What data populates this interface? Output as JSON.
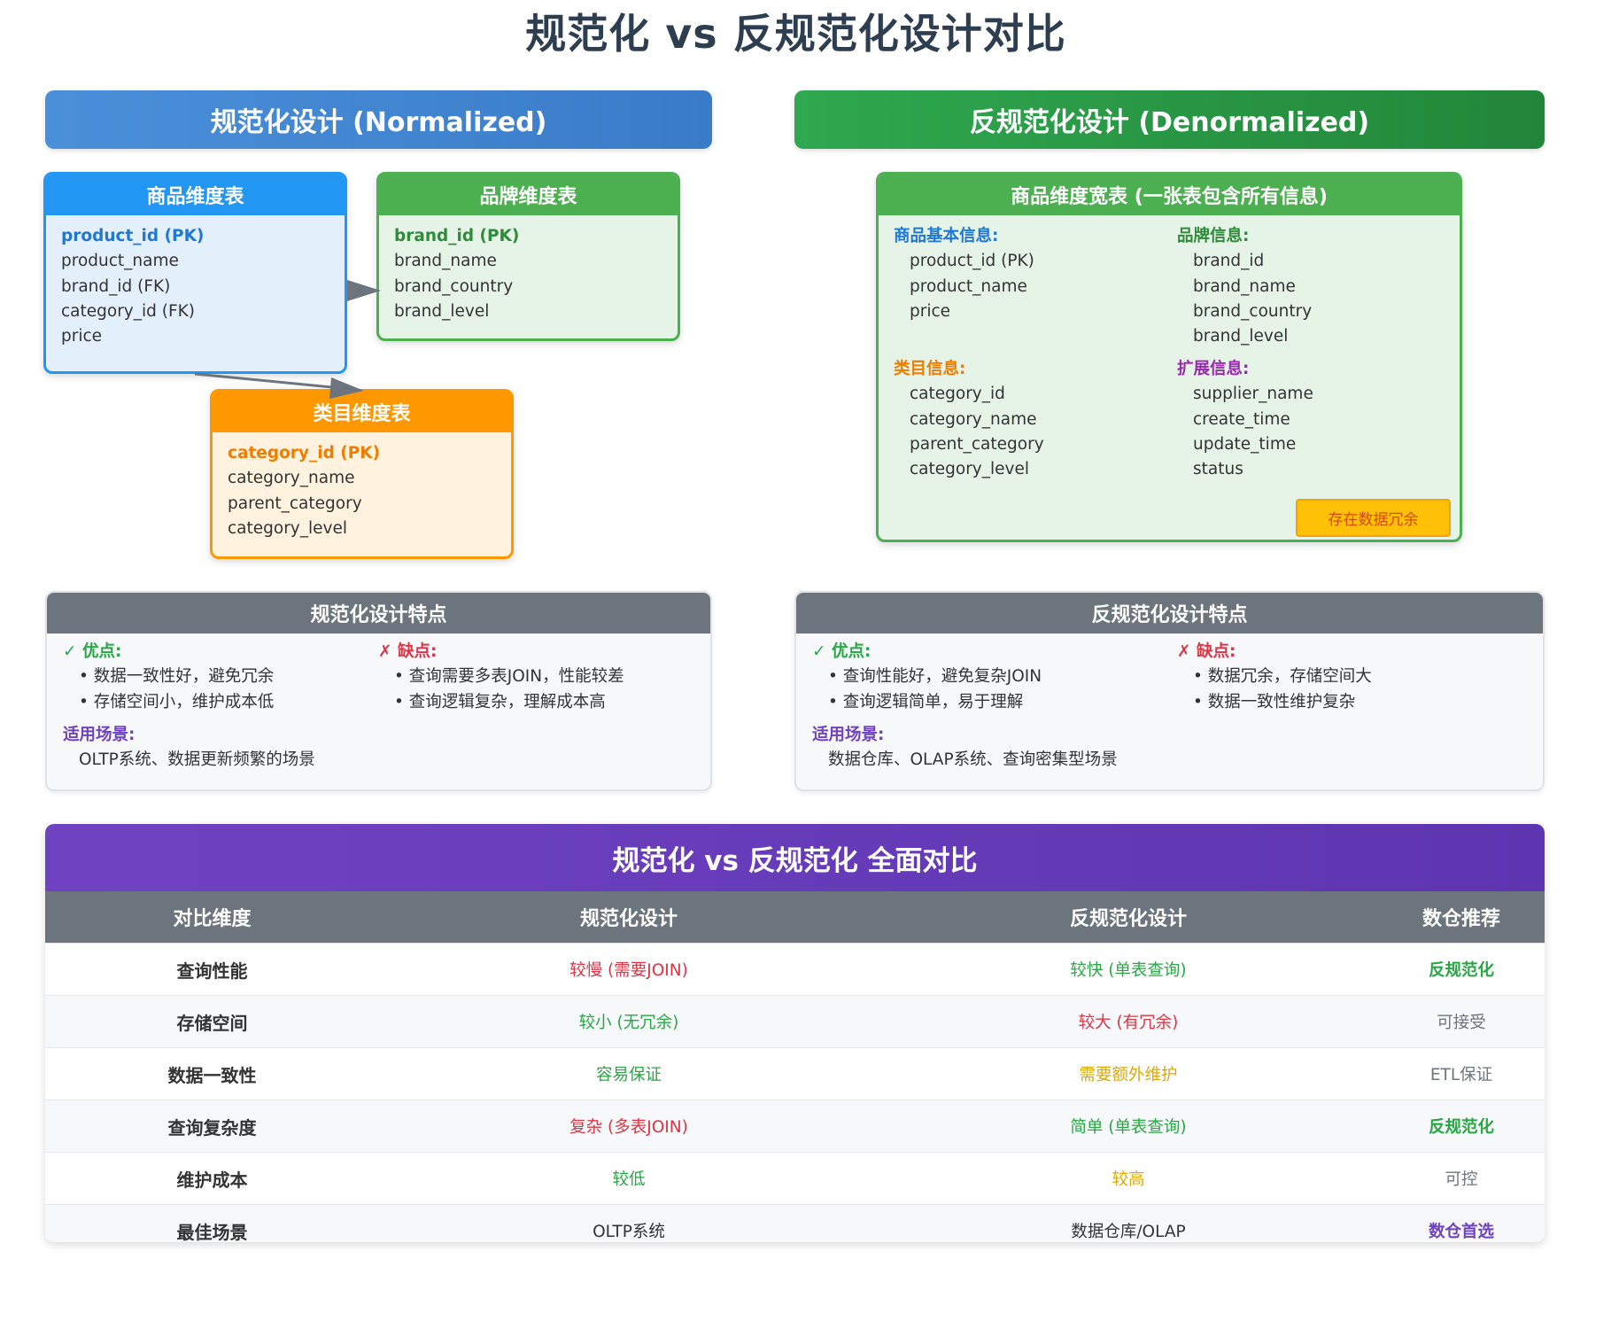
{
  "title": "规范化 vs 反规范化设计对比",
  "normalized": {
    "banner": "规范化设计 (Normalized)",
    "product_table": {
      "title": "商品维度表",
      "fields": [
        "product_id (PK)",
        "product_name",
        "brand_id (FK)",
        "category_id (FK)",
        "price"
      ]
    },
    "brand_table": {
      "title": "品牌维度表",
      "fields": [
        "brand_id (PK)",
        "brand_name",
        "brand_country",
        "brand_level"
      ]
    },
    "category_table": {
      "title": "类目维度表",
      "fields": [
        "category_id (PK)",
        "category_name",
        "parent_category",
        "category_level"
      ]
    },
    "features": {
      "title": "规范化设计特点",
      "pros_label": "✓ 优点:",
      "pros": [
        "• 数据一致性好，避免冗余",
        "• 存储空间小，维护成本低"
      ],
      "cons_label": "✗ 缺点:",
      "cons": [
        "• 查询需要多表JOIN，性能较差",
        "• 查询逻辑复杂，理解成本高"
      ],
      "scenario_label": "适用场景:",
      "scenario": "OLTP系统、数据更新频繁的场景"
    }
  },
  "denormalized": {
    "banner": "反规范化设计 (Denormalized)",
    "wide_table": {
      "title": "商品维度宽表 (一张表包含所有信息)",
      "groups": [
        {
          "label": "商品基本信息:",
          "color": "#1f78d1",
          "fields": [
            "product_id (PK)",
            "product_name",
            "price"
          ]
        },
        {
          "label": "品牌信息:",
          "color": "#2e8b3a",
          "fields": [
            "brand_id",
            "brand_name",
            "brand_country",
            "brand_level"
          ]
        },
        {
          "label": "类目信息:",
          "color": "#ef7d00",
          "fields": [
            "category_id",
            "category_name",
            "parent_category",
            "category_level"
          ]
        },
        {
          "label": "扩展信息:",
          "color": "#9c27b0",
          "fields": [
            "supplier_name",
            "create_time",
            "update_time",
            "status"
          ]
        }
      ],
      "redundancy_badge": "存在数据冗余"
    },
    "features": {
      "title": "反规范化设计特点",
      "pros_label": "✓ 优点:",
      "pros": [
        "• 查询性能好，避免复杂JOIN",
        "• 查询逻辑简单，易于理解"
      ],
      "cons_label": "✗ 缺点:",
      "cons": [
        "• 数据冗余，存储空间大",
        "• 数据一致性维护复杂"
      ],
      "scenario_label": "适用场景:",
      "scenario": "数据仓库、OLAP系统、查询密集型场景"
    }
  },
  "comparison": {
    "title": "规范化 vs 反规范化 全面对比",
    "headers": [
      "对比维度",
      "规范化设计",
      "反规范化设计",
      "数仓推荐"
    ],
    "rows": [
      {
        "dim": "查询性能",
        "norm": "较慢 (需要JOIN)",
        "norm_color": "red",
        "denorm": "较快 (单表查询)",
        "denorm_color": "green",
        "rec": "反规范化",
        "rec_color": "bgreen"
      },
      {
        "dim": "存储空间",
        "norm": "较小 (无冗余)",
        "norm_color": "green",
        "denorm": "较大 (有冗余)",
        "denorm_color": "red",
        "rec": "可接受",
        "rec_color": "gray"
      },
      {
        "dim": "数据一致性",
        "norm": "容易保证",
        "norm_color": "green",
        "denorm": "需要额外维护",
        "denorm_color": "yellow",
        "rec": "ETL保证",
        "rec_color": "gray"
      },
      {
        "dim": "查询复杂度",
        "norm": "复杂 (多表JOIN)",
        "norm_color": "red",
        "denorm": "简单 (单表查询)",
        "denorm_color": "green",
        "rec": "反规范化",
        "rec_color": "bgreen"
      },
      {
        "dim": "维护成本",
        "norm": "较低",
        "norm_color": "green",
        "denorm": "较高",
        "denorm_color": "yellow",
        "rec": "可控",
        "rec_color": "gray"
      },
      {
        "dim": "最佳场景",
        "norm": "OLTP系统",
        "norm_color": "dark",
        "denorm": "数据仓库/OLAP",
        "denorm_color": "dark",
        "rec": "数仓首选",
        "rec_color": "purple"
      }
    ]
  }
}
